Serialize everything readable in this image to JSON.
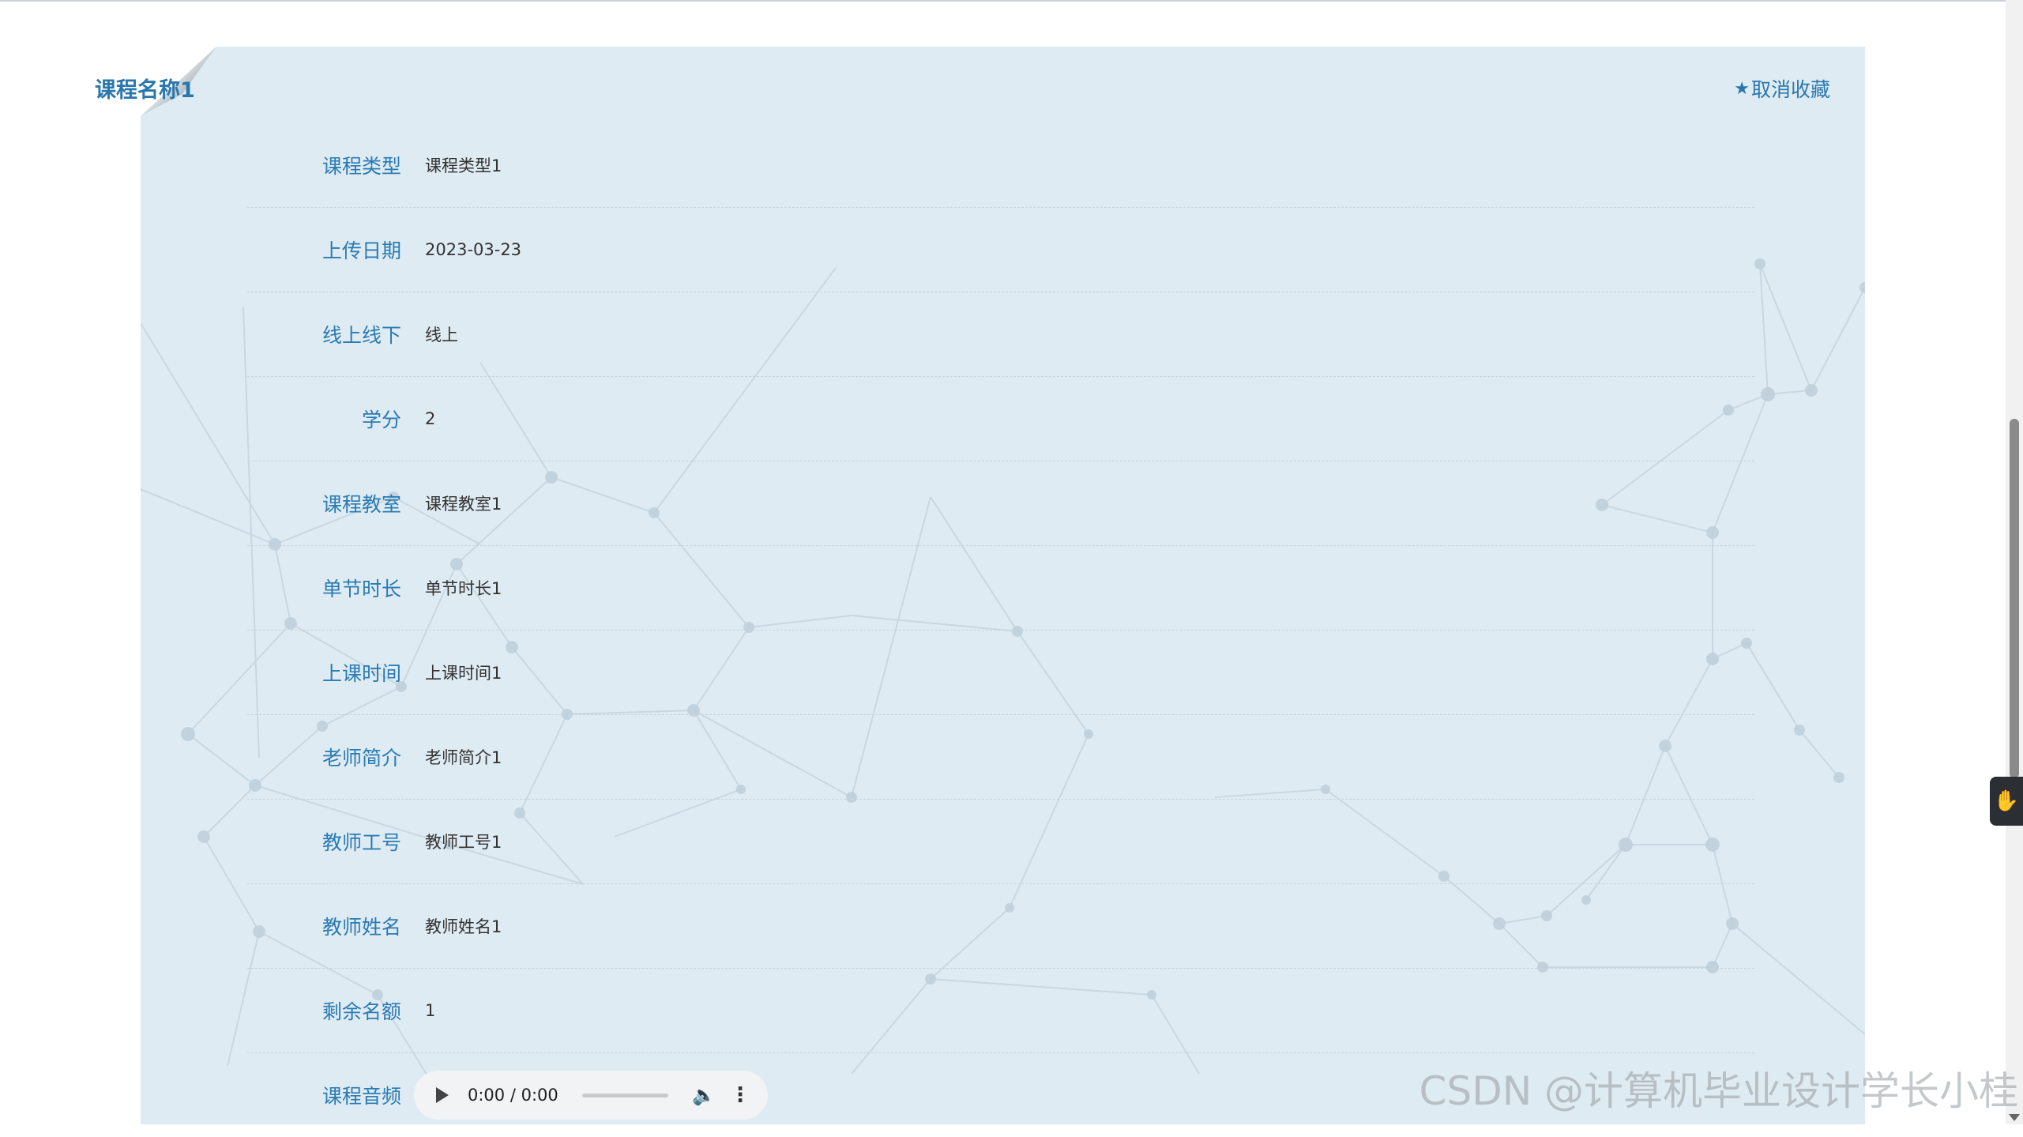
{
  "course": {
    "title": "课程名称1",
    "favorite_label": "取消收藏",
    "favorite_icon": "star-icon"
  },
  "details": [
    {
      "label": "课程类型",
      "value": "课程类型1"
    },
    {
      "label": "上传日期",
      "value": "2023-03-23"
    },
    {
      "label": "线上线下",
      "value": "线上"
    },
    {
      "label": "学分",
      "value": "2"
    },
    {
      "label": "课程教室",
      "value": "课程教室1"
    },
    {
      "label": "单节时长",
      "value": "单节时长1"
    },
    {
      "label": "上课时间",
      "value": "上课时间1"
    },
    {
      "label": "老师简介",
      "value": "老师简介1"
    },
    {
      "label": "教师工号",
      "value": "教师工号1"
    },
    {
      "label": "教师姓名",
      "value": "教师姓名1"
    },
    {
      "label": "剩余名额",
      "value": "1"
    }
  ],
  "audio": {
    "label": "课程音频",
    "time": "0:00 / 0:00"
  },
  "watermark": "CSDN @计算机毕业设计学长小桂",
  "colors": {
    "card_background": "#dfebf2",
    "label": "#2a7bb4",
    "title": "#2a77ad",
    "value": "#333333"
  }
}
